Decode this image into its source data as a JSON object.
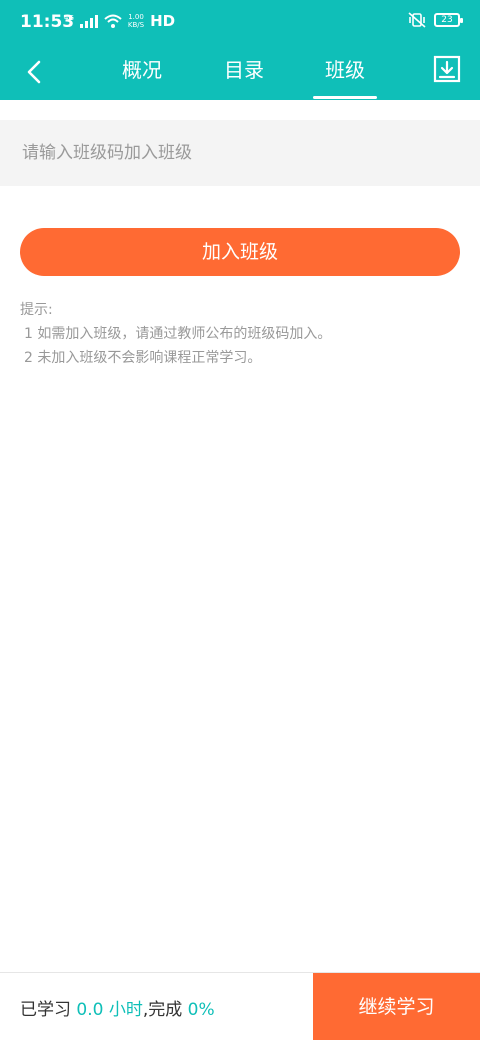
{
  "status_bar": {
    "time": "11:53",
    "network_badge": "4G",
    "speed_value": "1.00",
    "speed_unit": "KB/S",
    "hd_label": "HD",
    "battery_level": "23"
  },
  "nav": {
    "tabs": [
      {
        "label": "概况"
      },
      {
        "label": "目录"
      },
      {
        "label": "班级"
      }
    ],
    "active_tab": "班级"
  },
  "join_form": {
    "placeholder": "请输入班级码加入班级",
    "button_label": "加入班级"
  },
  "tips": {
    "title": "提示:",
    "items": [
      "1 如需加入班级，请通过教师公布的班级码加入。",
      "2 未加入班级不会影响课程正常学习。"
    ]
  },
  "footer": {
    "learned_label": "已学习",
    "hours_value": "0.0",
    "hours_unit": "小时",
    "complete_label": ",完成",
    "complete_value": "0%",
    "continue_label": "继续学习"
  },
  "colors": {
    "header_bg": "#0fbfb8",
    "accent_orange": "#ff6a33",
    "input_bg": "#f4f4f4",
    "tip_text": "#999999"
  }
}
